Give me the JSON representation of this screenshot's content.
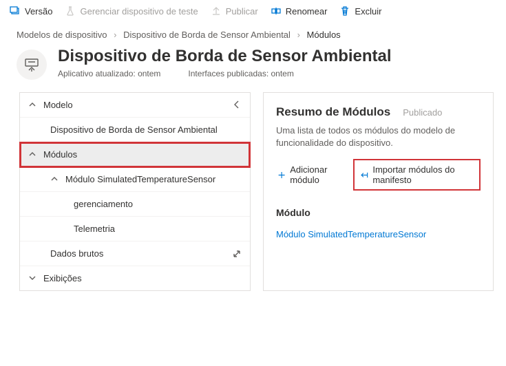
{
  "toolbar": {
    "version": "Versão",
    "manageTest": "Gerenciar dispositivo de teste",
    "publish": "Publicar",
    "rename": "Renomear",
    "delete": "Excluir"
  },
  "breadcrumb": {
    "root": "Modelos de dispositivo",
    "device": "Dispositivo de Borda de Sensor Ambiental",
    "current": "Módulos"
  },
  "header": {
    "title": "Dispositivo de Borda de Sensor Ambiental",
    "updated": "Aplicativo atualizado: ontem",
    "published": "Interfaces publicadas: ontem"
  },
  "tree": {
    "model": "Modelo",
    "deviceName": "Dispositivo de Borda de Sensor Ambiental",
    "modules": "Módulos",
    "moduleSim": "Módulo SimulatedTemperatureSensor",
    "management": "gerenciamento",
    "telemetry": "Telemetria",
    "rawData": "Dados brutos",
    "views": "Exibições"
  },
  "summary": {
    "title": "Resumo de Módulos",
    "status": "Publicado",
    "desc": "Uma lista de todos os módulos do modelo de funcionalidade do dispositivo.",
    "addModule": "Adicionar módulo",
    "importManifest": "Importar módulos do manifesto",
    "moduleHeading": "Módulo",
    "moduleLink": "Módulo SimulatedTemperatureSensor"
  }
}
